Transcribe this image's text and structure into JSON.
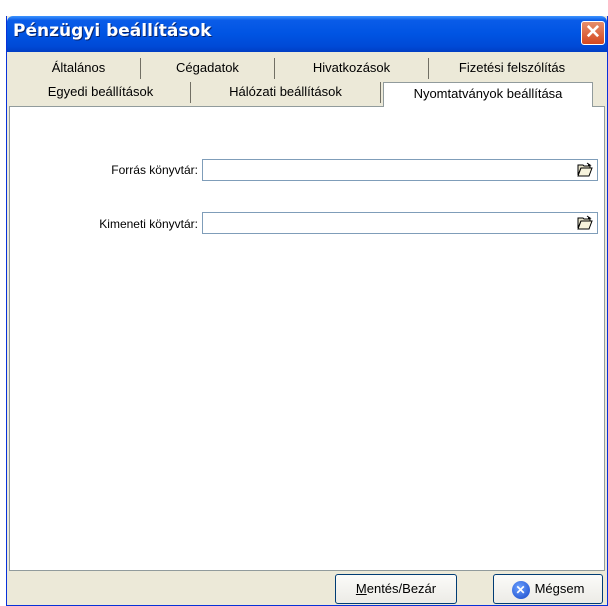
{
  "window": {
    "title": "Pénzügyi beállítások",
    "close_glyph": "✕"
  },
  "tabs": {
    "row1": [
      "Általános",
      "Cégadatok",
      "Hivatkozások",
      "Fizetési felszólítás"
    ],
    "row2": [
      "Egyedi beállítások",
      "Hálózati beállítások"
    ],
    "active": "Nyomtatványok beállítása"
  },
  "form": {
    "source_label": "Forrás könyvtár:",
    "source_value": "",
    "output_label": "Kimeneti könyvtár:",
    "output_value": "",
    "browse_icon": "folder-open-icon"
  },
  "buttons": {
    "save_prefix": "M",
    "save_rest": "entés/Bezár",
    "cancel_label": "Mégsem"
  }
}
